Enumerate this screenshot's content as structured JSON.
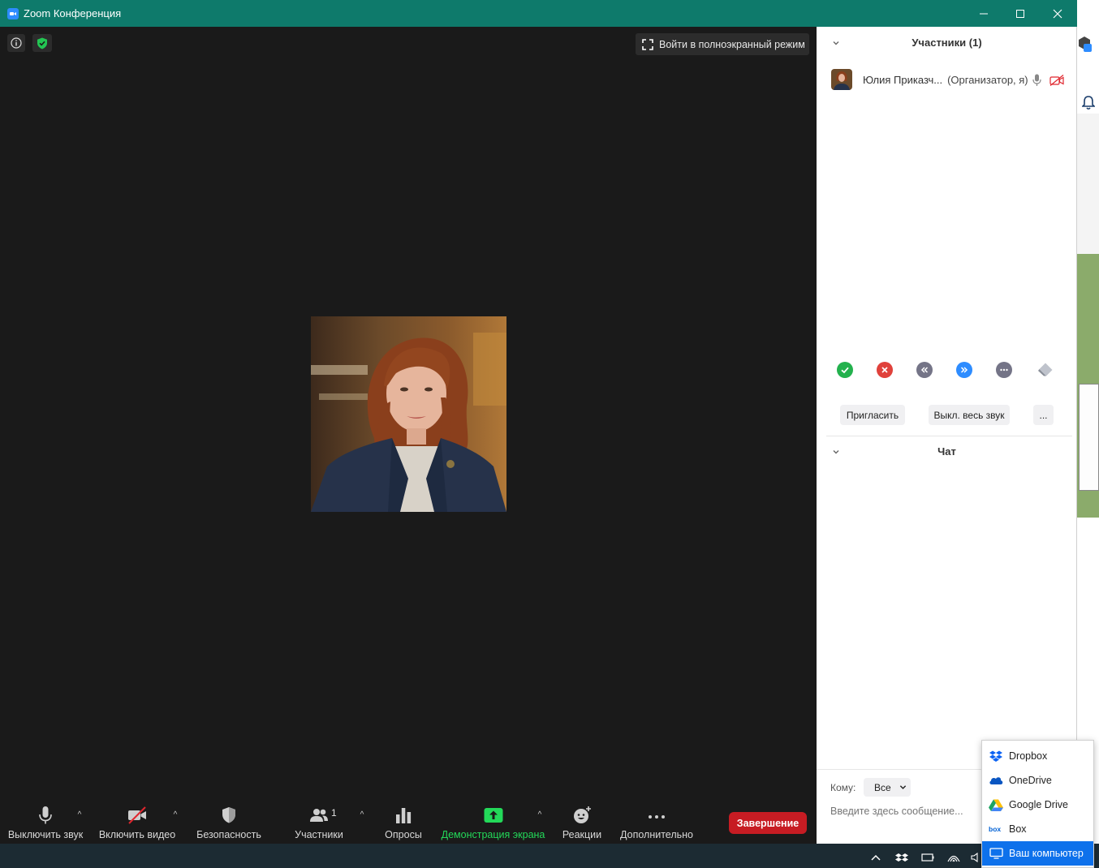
{
  "window": {
    "title": "Zoom Конференция"
  },
  "video": {
    "fullscreen_label": "Войти в полноэкранный режим"
  },
  "toolbar": {
    "mute_label": "Выключить звук",
    "video_label": "Включить видео",
    "security_label": "Безопасность",
    "participants_label": "Участники",
    "participants_count": "1",
    "polls_label": "Опросы",
    "share_label": "Демонстрация экрана",
    "reactions_label": "Реакции",
    "more_label": "Дополнительно",
    "end_label": "Завершение"
  },
  "participants_panel": {
    "title": "Участники (1)",
    "participant": {
      "name": "Юлия Приказч...",
      "role": "(Организатор, я)"
    },
    "invite_label": "Пригласить",
    "mute_all_label": "Выкл. весь звук",
    "more_label": "..."
  },
  "chat_panel": {
    "title": "Чат",
    "to_label": "Кому:",
    "to_value": "Все",
    "message_placeholder": "Введите здесь сообщение..."
  },
  "share_menu": {
    "items": [
      {
        "label": "Dropbox",
        "icon": "dropbox-icon"
      },
      {
        "label": "OneDrive",
        "icon": "onedrive-icon"
      },
      {
        "label": "Google Drive",
        "icon": "google-drive-icon"
      },
      {
        "label": "Box",
        "icon": "box-icon"
      },
      {
        "label": "Ваш компьютер",
        "icon": "computer-icon",
        "selected": true
      }
    ]
  },
  "colors": {
    "titlebar": "#0e7a6b",
    "video_bg": "#1a1a1a",
    "end_button": "#c71c23",
    "share_green": "#23d959",
    "selected_item": "#0e71eb"
  }
}
